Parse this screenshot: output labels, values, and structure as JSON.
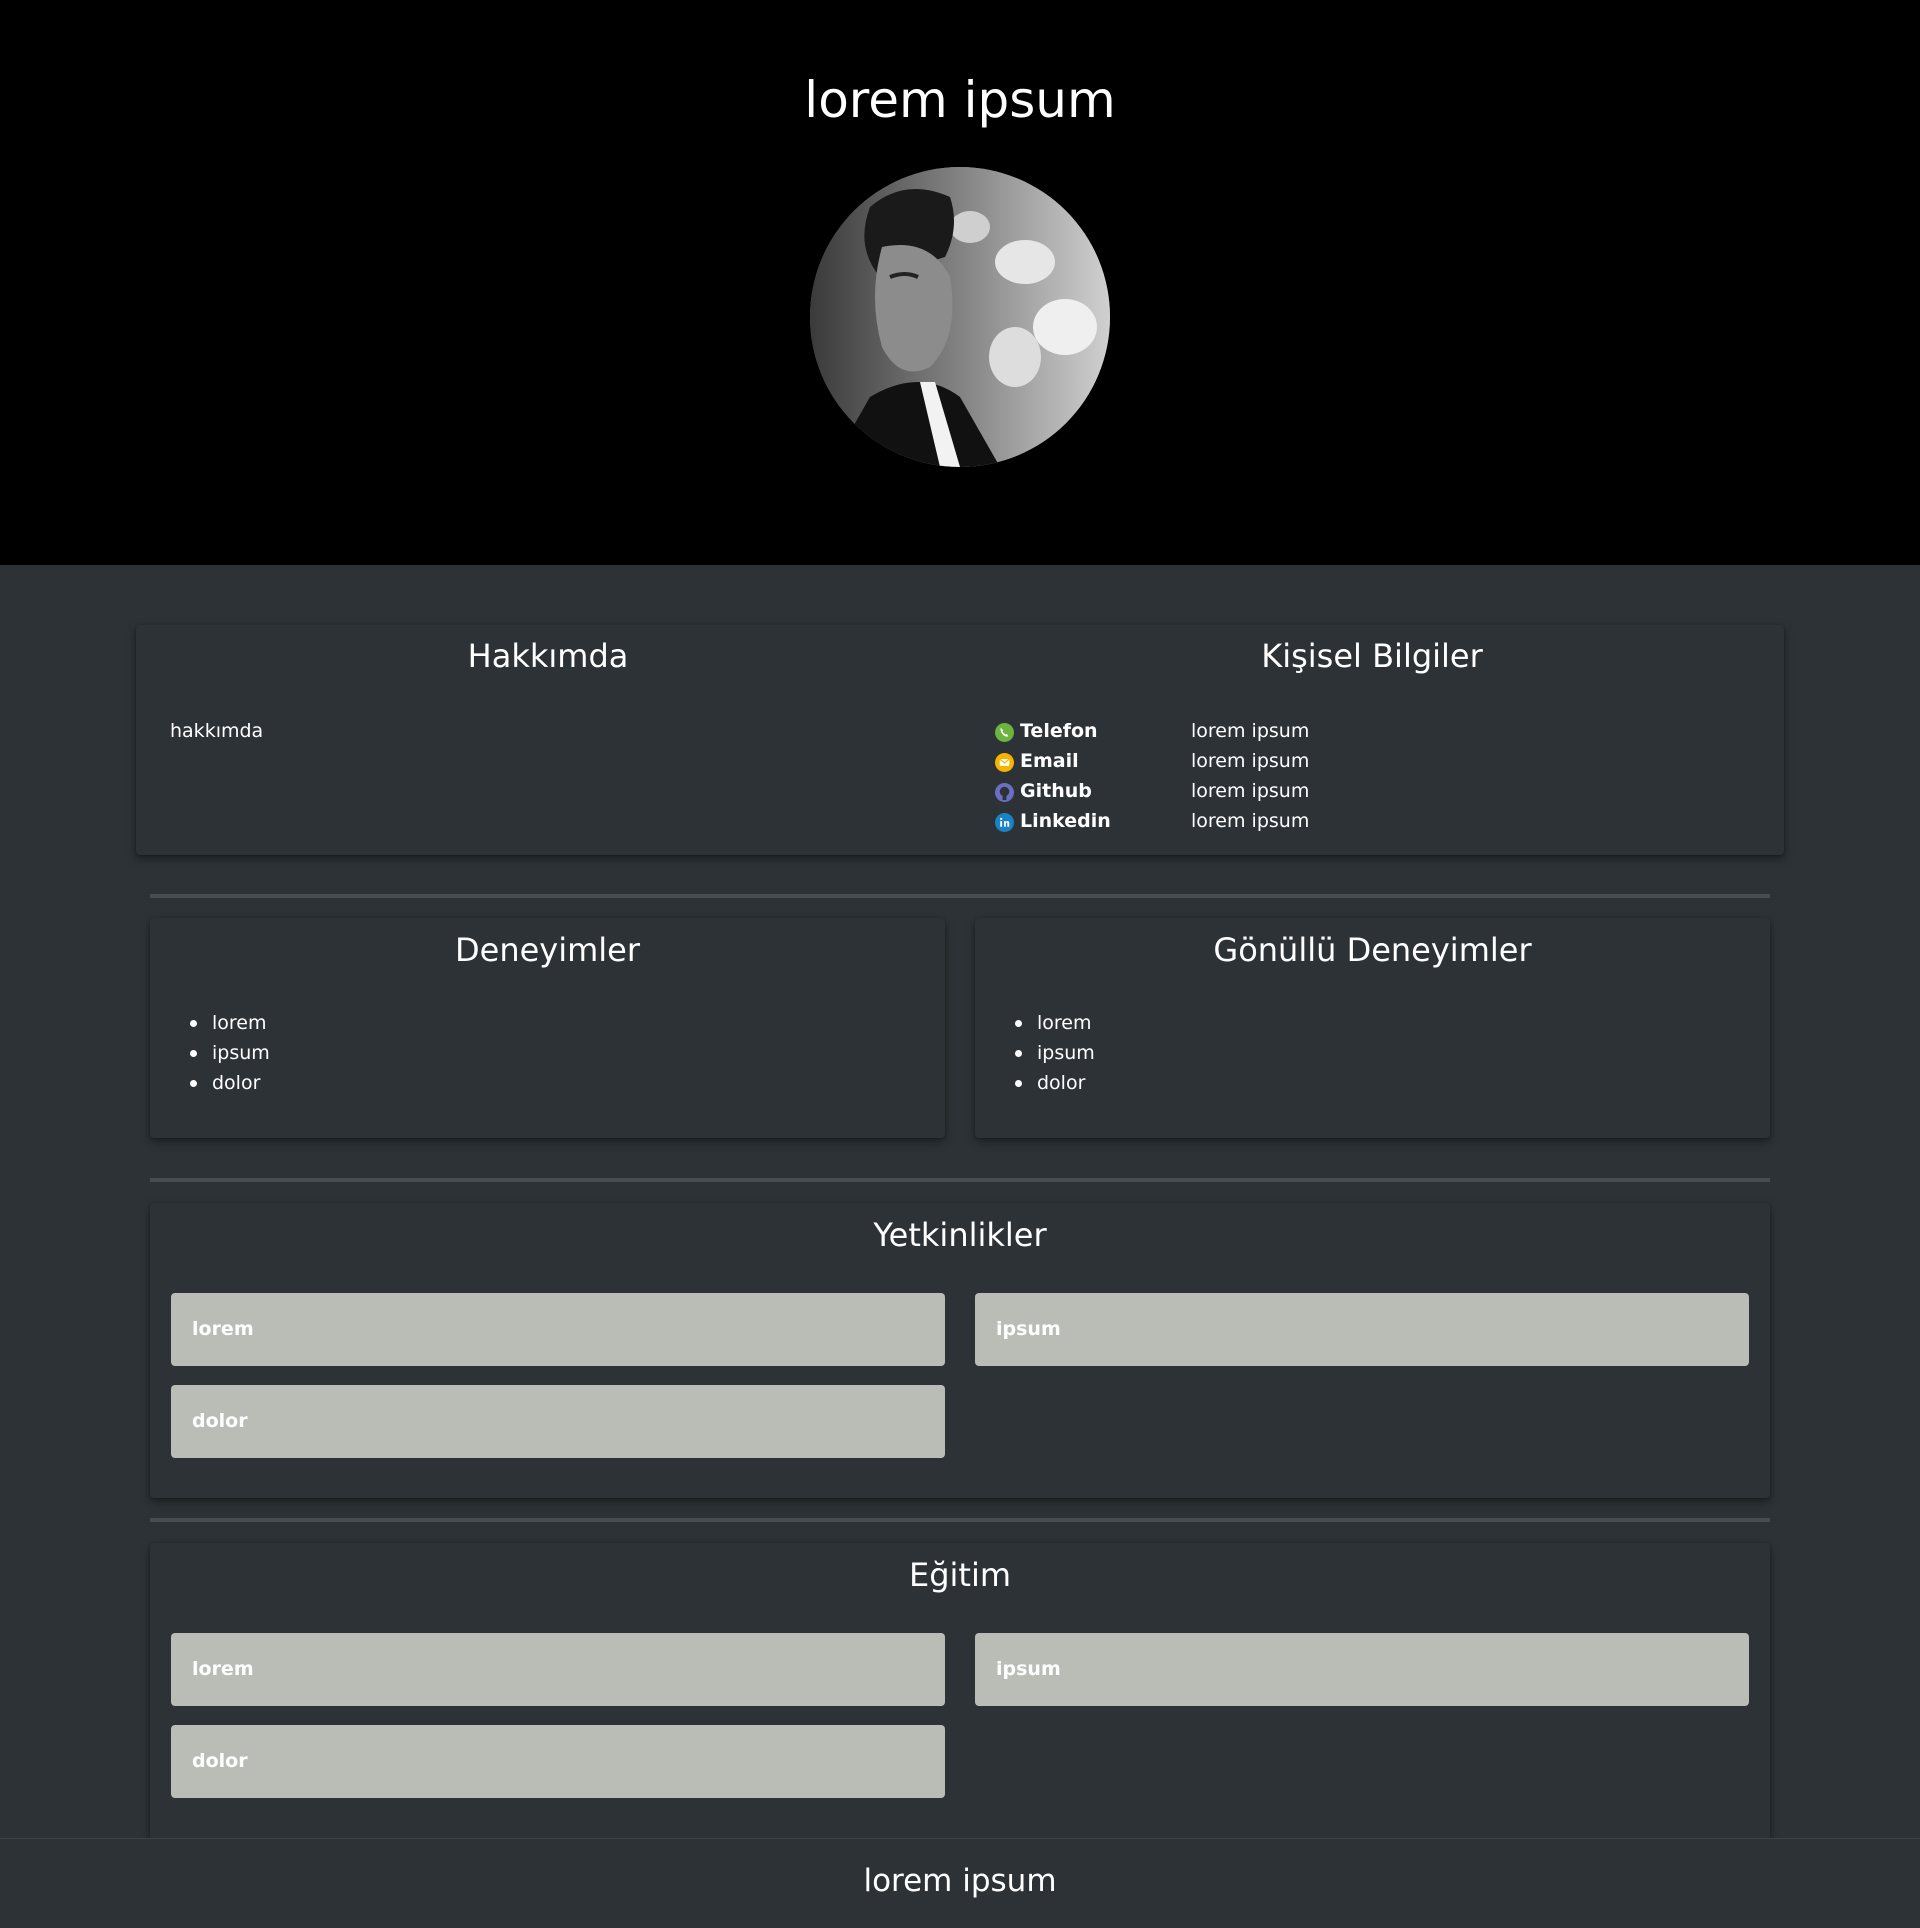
{
  "header": {
    "title": "lorem ipsum",
    "avatar_icon": "profile-photo"
  },
  "about": {
    "title": "Hakkımda",
    "text": "hakkımda"
  },
  "personal": {
    "title": "Kişisel Bilgiler",
    "rows": [
      {
        "label": "Telefon",
        "value": "lorem ipsum",
        "icon": "phone-icon",
        "color": "#6cb33f"
      },
      {
        "label": "Email",
        "value": "lorem ipsum",
        "icon": "email-icon",
        "color": "#f5b400"
      },
      {
        "label": "Github",
        "value": "lorem ipsum",
        "icon": "github-icon",
        "color": "#6a6fc4"
      },
      {
        "label": "Linkedin",
        "value": "lorem ipsum",
        "icon": "linkedin-icon",
        "color": "#1a83c6"
      }
    ]
  },
  "experience": {
    "title": "Deneyimler",
    "items": [
      "lorem",
      "ipsum",
      "dolor"
    ]
  },
  "volunteer": {
    "title": "Gönüllü Deneyimler",
    "items": [
      "lorem",
      "ipsum",
      "dolor"
    ]
  },
  "skills": {
    "title": "Yetkinlikler",
    "items": [
      "lorem",
      "ipsum",
      "dolor"
    ]
  },
  "education": {
    "title": "Eğitim",
    "items": [
      "lorem",
      "ipsum",
      "dolor"
    ]
  },
  "footer": {
    "text": "lorem ipsum"
  },
  "colors": {
    "header_bg": "#000000",
    "page_bg": "#2c3236",
    "tile_bg": "#babdb6"
  }
}
